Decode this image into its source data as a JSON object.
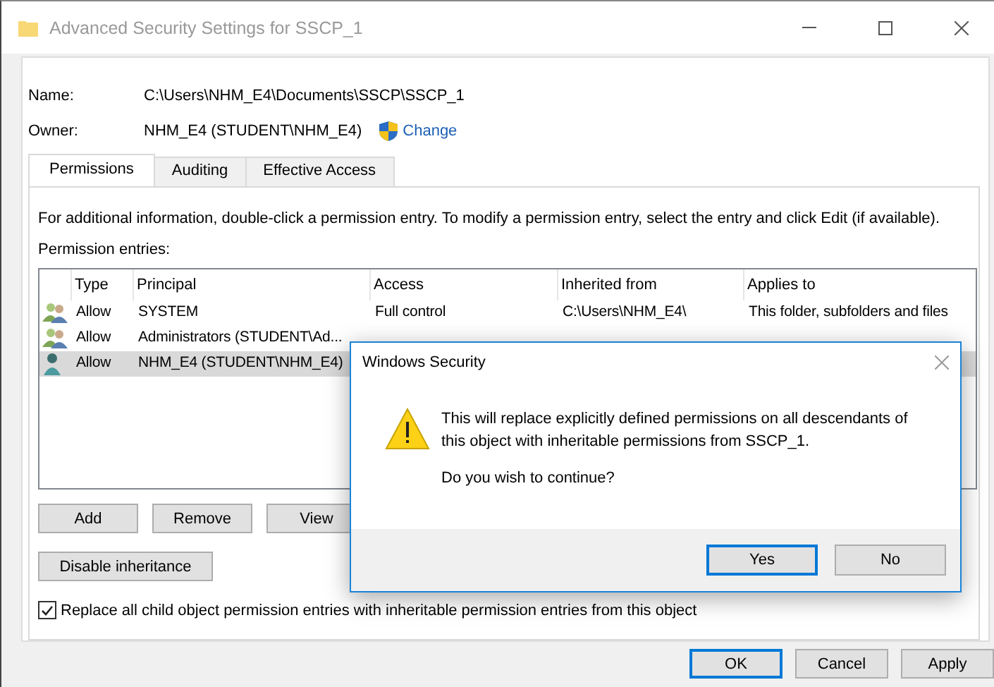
{
  "window": {
    "title": "Advanced Security Settings for SSCP_1"
  },
  "name": {
    "label": "Name:",
    "value": "C:\\Users\\NHM_E4\\Documents\\SSCP\\SSCP_1"
  },
  "owner": {
    "label": "Owner:",
    "value": "NHM_E4 (STUDENT\\NHM_E4)",
    "link": "Change"
  },
  "tabs": [
    {
      "label": "Permissions",
      "selected": true
    },
    {
      "label": "Auditing",
      "selected": false
    },
    {
      "label": "Effective Access",
      "selected": false
    }
  ],
  "info": "For additional information, double-click a permission entry. To modify a permission entry, select the entry and click Edit (if available).",
  "entries_label": "Permission entries:",
  "table": {
    "columns": [
      "Type",
      "Principal",
      "Access",
      "Inherited from",
      "Applies to"
    ],
    "rows": [
      {
        "kind": "group",
        "selected": false,
        "cells": [
          "Allow",
          "SYSTEM",
          "Full control",
          "C:\\Users\\NHM_E4\\",
          "This folder, subfolders and files"
        ]
      },
      {
        "kind": "group",
        "selected": false,
        "cells": [
          "Allow",
          "Administrators (STUDENT\\Ad..."
        ]
      },
      {
        "kind": "user",
        "selected": true,
        "cells": [
          "Allow",
          "NHM_E4 (STUDENT\\NHM_E4)"
        ]
      }
    ]
  },
  "entry_buttons": [
    "Add",
    "Remove",
    "View"
  ],
  "inheritance_button": "Disable inheritance",
  "replace_checkbox": {
    "label": "Replace all child object permission entries with inheritable permission entries from this object",
    "checked": true
  },
  "footer_buttons": [
    {
      "label": "OK",
      "default": true
    },
    {
      "label": "Cancel",
      "default": false
    },
    {
      "label": "Apply",
      "default": false
    }
  ],
  "dialog": {
    "title": "Windows Security",
    "message": "This will replace explicitly defined permissions on all descendants of this object with inheritable permissions from SSCP_1.",
    "question": "Do you wish to continue?",
    "buttons": [
      {
        "label": "Yes",
        "default": true
      },
      {
        "label": "No",
        "default": false
      }
    ]
  }
}
